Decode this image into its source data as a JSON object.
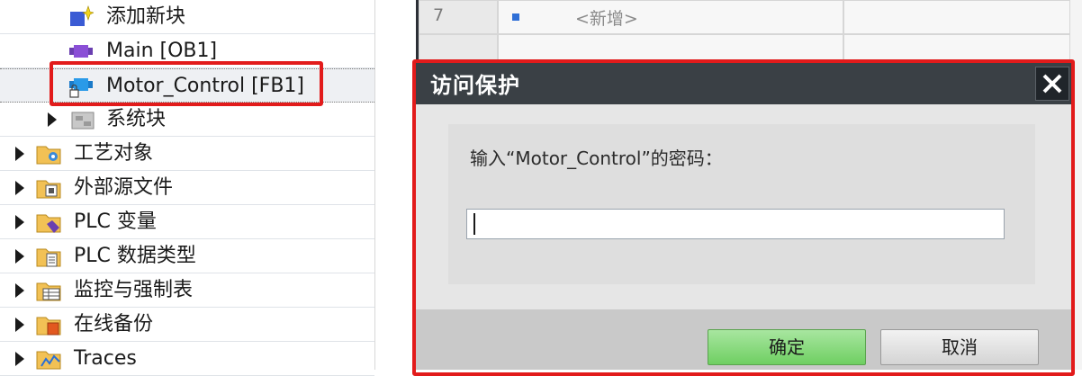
{
  "tree": {
    "items": [
      {
        "label": "添加新块"
      },
      {
        "label": "Main [OB1]"
      },
      {
        "label": "Motor_Control [FB1]"
      },
      {
        "label": "系统块"
      },
      {
        "label": "工艺对象"
      },
      {
        "label": "外部源文件"
      },
      {
        "label": "PLC 变量"
      },
      {
        "label": "PLC 数据类型"
      },
      {
        "label": "监控与强制表"
      },
      {
        "label": "在线备份"
      },
      {
        "label": "Traces"
      }
    ]
  },
  "editor": {
    "row_number": "7",
    "new_entry": "<新增>"
  },
  "dialog": {
    "title": "访问保护",
    "prompt": "输入“Motor_Control”的密码：",
    "password_value": "",
    "ok_label": "确定",
    "cancel_label": "取消"
  },
  "colors": {
    "highlight": "#e21b1b",
    "titlebar": "#3a4045",
    "ok_button": "#6fcf62"
  }
}
